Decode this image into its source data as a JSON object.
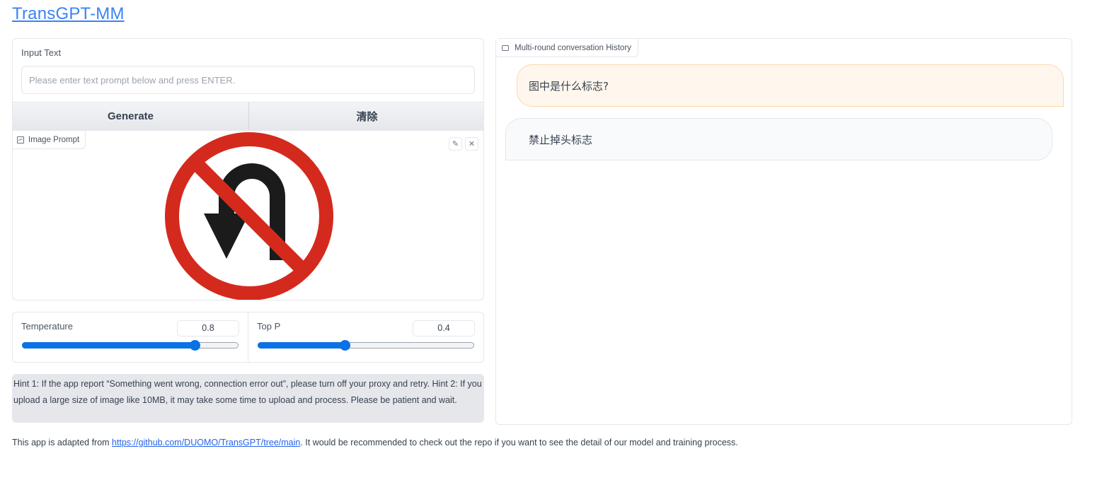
{
  "app": {
    "title": "TransGPT-MM"
  },
  "input": {
    "label": "Input Text",
    "placeholder": "Please enter text prompt below and press ENTER."
  },
  "buttons": {
    "generate": "Generate",
    "clear": "清除"
  },
  "image_prompt": {
    "label": "Image Prompt",
    "image_desc": "no-u-turn-sign"
  },
  "sliders": {
    "temperature": {
      "label": "Temperature",
      "value": "0.8",
      "fraction": 0.8
    },
    "top_p": {
      "label": "Top P",
      "value": "0.4",
      "fraction": 0.4
    }
  },
  "hint": "Hint 1: If the app report “Something went wrong, connection error out”, please turn off your proxy and retry. Hint 2: If you upload a large size of image like 10MB, it may take some time to upload and process. Please be patient and wait.",
  "chat": {
    "label": "Multi-round conversation History",
    "messages": [
      {
        "role": "user",
        "text": "图中是什么标志?"
      },
      {
        "role": "bot",
        "text": "禁止掉头标志"
      }
    ]
  },
  "footer": {
    "prefix": "This app is adapted from ",
    "link_text": "https://github.com/DUOMO/TransGPT/tree/main",
    "suffix": ". It would be recommended to check out the repo if you want to see the detail of our model and training process."
  },
  "colors": {
    "accent": "#3b82f6",
    "slider": "#0a72e6",
    "user_bubble": "#fff7ed",
    "sign_red": "#d42a1e"
  }
}
